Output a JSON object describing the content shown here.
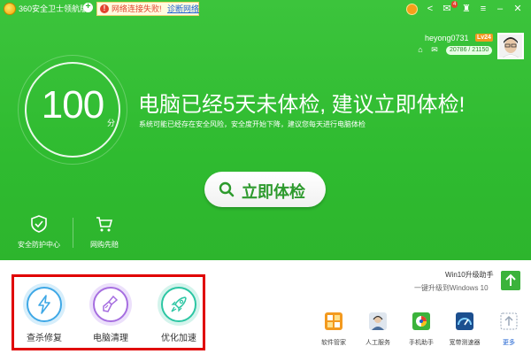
{
  "titlebar": {
    "app_title": "360安全卫士领航版",
    "alert_text": "网络连接失败!",
    "alert_link": "诊断网络",
    "unread_count": "4"
  },
  "account": {
    "username": "heyong0731",
    "level": "Lv24",
    "exp": "20786 / 21150"
  },
  "score": {
    "value": "100",
    "unit": "分"
  },
  "main": {
    "headline": "电脑已经5天未体检, 建议立即体检!",
    "subline": "系统可能已经存在安全风险，安全度开始下降，建议您每天进行电脑体检",
    "check_button": "立即体检"
  },
  "features": [
    {
      "label": "安全防护中心",
      "icon": "shield-check-icon"
    },
    {
      "label": "网购先赔",
      "icon": "shopping-cart-icon"
    }
  ],
  "tools": [
    {
      "label": "查杀修复",
      "icon": "lightning-icon",
      "color": "#3fa8e6"
    },
    {
      "label": "电脑清理",
      "icon": "broom-icon",
      "color": "#a66ee0"
    },
    {
      "label": "优化加速",
      "icon": "rocket-icon",
      "color": "#2cc6a3"
    }
  ],
  "win10": {
    "title": "Win10升级助手",
    "subtitle": "一键升级到Windows 10"
  },
  "apps": [
    {
      "label": "软件管家",
      "icon": "software-manager-icon"
    },
    {
      "label": "人工服务",
      "icon": "human-service-icon"
    },
    {
      "label": "手机助手",
      "icon": "mobile-assistant-icon"
    },
    {
      "label": "宽带测速器",
      "icon": "speed-test-icon"
    },
    {
      "label": "更多",
      "icon": "more-icon"
    }
  ],
  "colors": {
    "header_green": "#3cc43c",
    "button_text_green": "#2d9a2d",
    "highlight_red": "#e00000",
    "more_blue": "#1a5fd0"
  }
}
